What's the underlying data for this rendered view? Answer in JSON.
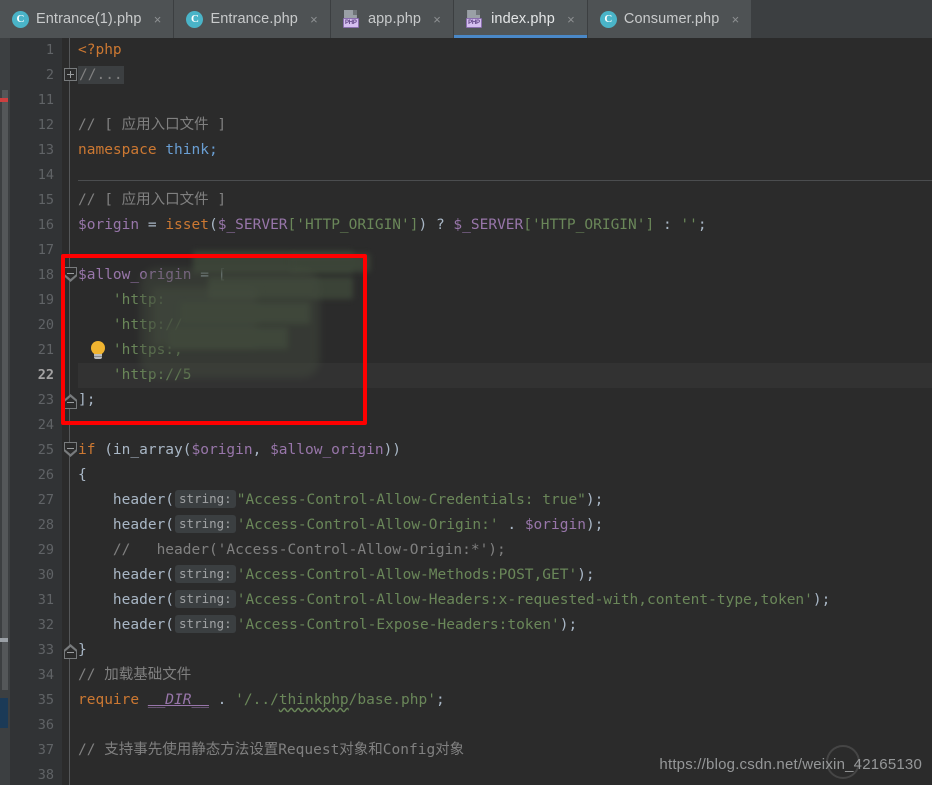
{
  "window": {
    "app": "PhpStorm Editor",
    "theme_bg": "#2b2b2b",
    "accent": "#4a88c7"
  },
  "tabs": [
    {
      "label": "Entrance(1).php",
      "icon": "class-c-icon",
      "icon_letter": "C",
      "active": false,
      "close": "×"
    },
    {
      "label": "Entrance.php",
      "icon": "class-c-icon",
      "icon_letter": "C",
      "active": false,
      "close": "×"
    },
    {
      "label": "app.php",
      "icon": "php-file-icon",
      "icon_letter": "PHP",
      "active": false,
      "close": "×"
    },
    {
      "label": "index.php",
      "icon": "php-file-icon",
      "icon_letter": "PHP",
      "active": true,
      "close": "×"
    },
    {
      "label": "Consumer.php",
      "icon": "class-c-icon",
      "icon_letter": "C",
      "active": false,
      "close": "×"
    }
  ],
  "editor": {
    "current_line": 22,
    "line_numbers": [
      1,
      2,
      11,
      12,
      13,
      14,
      15,
      16,
      17,
      18,
      19,
      20,
      21,
      22,
      23,
      24,
      25,
      26,
      27,
      28,
      29,
      30,
      31,
      32,
      33,
      34,
      35,
      36,
      37,
      38
    ],
    "folded_region_label": "//...",
    "intention_icon": "lightbulb-icon",
    "parameter_hint": "string:",
    "lines": {
      "l1": "<?php",
      "l2": "//...",
      "l12": "// [ 应用入口文件 ]",
      "l13_kw": "namespace",
      "l13_ns": "think;",
      "l15": "// [ 应用入口文件 ]",
      "l16_var": "$origin",
      "l16_eq": " = ",
      "l16_fn": "isset",
      "l16_a": "(",
      "l16_srv": "$_SERVER",
      "l16_idx": "['HTTP_ORIGIN']",
      "l16_b": ") ? ",
      "l16_srv2": "$_SERVER",
      "l16_idx2": "['HTTP_ORIGIN']",
      "l16_c": " : ",
      "l16_empty": "''",
      "l16_semi": ";",
      "l18_var": "$allow_origin",
      "l18_rest": " = [",
      "l19": "    'http:",
      "l20": "    'http://",
      "l20_tail": ",",
      "l21": "    'https:,",
      "l22": "    'http://5",
      "l23": "];",
      "l25_kw": "if",
      "l25_rest": " (in_array(",
      "l25_v1": "$origin",
      "l25_sep": ", ",
      "l25_v2": "$allow_origin",
      "l25_end": "))",
      "l26": "{",
      "l27_fn": "    header(",
      "l27_str": "\"Access-Control-Allow-Credentials: true\"",
      "l27_end": ");",
      "l28_fn": "    header(",
      "l28_str": "'Access-Control-Allow-Origin:'",
      "l28_dot": " . ",
      "l28_var": "$origin",
      "l28_end": ");",
      "l29": "    //   header('Access-Control-Allow-Origin:*');",
      "l30_fn": "    header(",
      "l30_str": "'Access-Control-Allow-Methods:POST,GET'",
      "l30_end": ");",
      "l31_fn": "    header(",
      "l31_str": "'Access-Control-Allow-Headers:x-requested-with,content-type,token'",
      "l31_end": ");",
      "l32_fn": "    header(",
      "l32_str": "'Access-Control-Expose-Headers:token'",
      "l32_end": ");",
      "l33": "}",
      "l34": "// 加载基础文件",
      "l35_kw": "require",
      "l35_const": "__DIR__",
      "l35_dot": " . ",
      "l35_str_a": "'/../",
      "l35_str_b": "thinkphp",
      "l35_str_c": "/base.php'",
      "l35_semi": ";",
      "l37": "// 支持事先使用静态方法设置Request对象和Config对象"
    }
  },
  "annotation": {
    "highlight_box_color": "#ff0000",
    "highlight_target": "$allow_origin array literal"
  },
  "watermark": {
    "text": "https://blog.csdn.net/weixin_42165130"
  }
}
